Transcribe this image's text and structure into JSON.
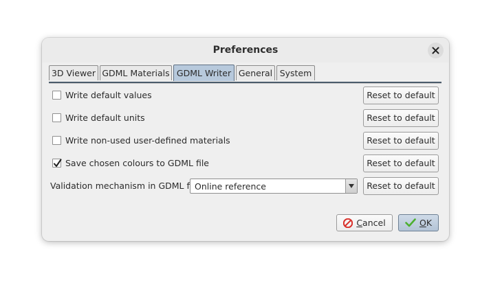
{
  "dialog": {
    "title": "Preferences"
  },
  "tabs": [
    {
      "label": "3D Viewer"
    },
    {
      "label": "GDML Materials"
    },
    {
      "label": "GDML Writer",
      "active": true
    },
    {
      "label": "General"
    },
    {
      "label": "System"
    }
  ],
  "options": [
    {
      "label": "Write default values",
      "checked": false,
      "reset_label": "Reset to default"
    },
    {
      "label": "Write default units",
      "checked": false,
      "reset_label": "Reset to default"
    },
    {
      "label": "Write non-used user-defined materials",
      "checked": false,
      "reset_label": "Reset to default"
    },
    {
      "label": "Save chosen colours to GDML file",
      "checked": true,
      "reset_label": "Reset to default"
    }
  ],
  "validation": {
    "label": "Validation mechanism in GDML file",
    "selected": "Online reference",
    "reset_label": "Reset to default"
  },
  "footer": {
    "cancel_mnemonic": "C",
    "cancel_rest": "ancel",
    "ok_mnemonic": "O",
    "ok_rest": "K"
  },
  "colors": {
    "active_tab": "#b7c9dc",
    "cancel_icon": "#d9302a",
    "ok_icon": "#4caf2f"
  },
  "icons": {
    "close": "close-icon",
    "cancel": "cancel-icon",
    "ok": "checkmark-icon",
    "dropdown": "chevron-down-icon"
  }
}
